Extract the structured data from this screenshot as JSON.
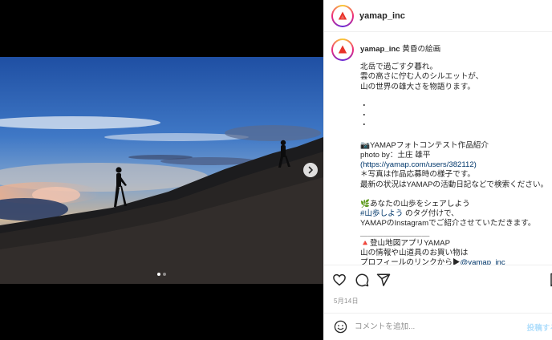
{
  "account": {
    "username": "yamap_inc",
    "avatar_icon": "yamap-logo-icon",
    "brand_color": "#e8332a"
  },
  "caption": {
    "username": "yamap_inc",
    "title": "黄昏の絵画",
    "lines": [
      "北岳で過ごす夕暮れ。",
      "雲の高さに佇む人のシルエットが、",
      "山の世界の雄大さを物語ります。",
      "",
      "・",
      "・",
      "・",
      "",
      "📷YAMAPフォトコンテスト作品紹介",
      "photo by：土庄 雄平",
      "(https://yamap.com/users/382112)",
      "＊写真は作品応募時の様子です。",
      "最新の状況はYAMAPの活動日記などで検索ください。",
      "",
      "🌿あなたの山歩をシェアしよう",
      "",
      "YAMAPのInstagramでご紹介させていただきます。",
      "＿＿＿＿＿＿＿＿＿",
      "🔺登山地図アプリYAMAP",
      "山の情報や山道具のお買い物は",
      ""
    ],
    "hashtag_line": {
      "hashtag": "#山歩しよう",
      "rest": " のタグ付けで、"
    },
    "profile_line": {
      "text": "プロフィールのリンクから▶",
      "mention": "@yamap_inc"
    }
  },
  "carousel": {
    "total_slides": 2,
    "active_slide": 1,
    "next_icon": "chevron-right-icon"
  },
  "actions": {
    "like_icon": "heart-icon",
    "comment_icon": "comment-icon",
    "share_icon": "send-icon",
    "save_icon": "bookmark-icon"
  },
  "date": "5月14日",
  "comment": {
    "placeholder": "コメントを追加...",
    "post_label": "投稿する",
    "emoji_icon": "emoji-icon"
  }
}
